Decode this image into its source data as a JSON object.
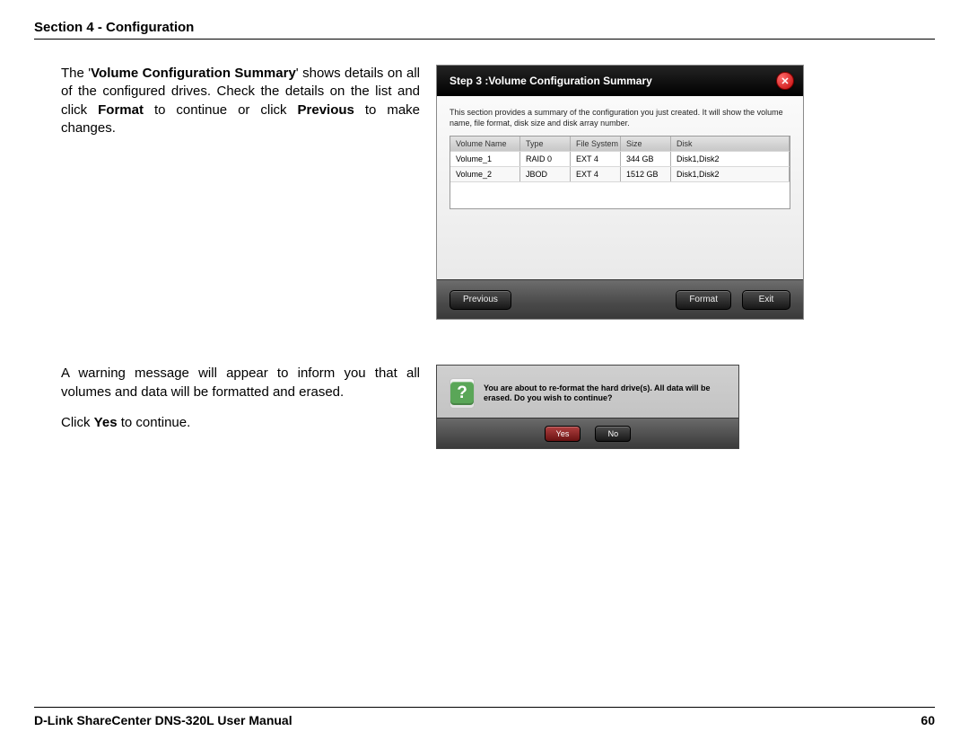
{
  "header": "Section 4 - Configuration",
  "para1_a": "The '",
  "para1_b": "Volume Configuration Summary",
  "para1_c": "' shows details on all of the configured drives. Check the details on the list and click ",
  "para1_d": "Format",
  "para1_e": " to continue or click ",
  "para1_f": "Previous",
  "para1_g": " to make changes.",
  "wizard": {
    "title": "Step 3 :Volume Configuration Summary",
    "desc": "This section provides a summary of the configuration you just created. It will show the volume name, file format, disk size and disk array number.",
    "headers": {
      "name": "Volume Name",
      "type": "Type",
      "fs": "File System",
      "size": "Size",
      "disk": "Disk"
    },
    "rows": [
      {
        "name": "Volume_1",
        "type": "RAID 0",
        "fs": "EXT 4",
        "size": "344 GB",
        "disk": "Disk1,Disk2"
      },
      {
        "name": "Volume_2",
        "type": "JBOD",
        "fs": "EXT 4",
        "size": "1512 GB",
        "disk": "Disk1,Disk2"
      }
    ],
    "previous": "Previous",
    "format": "Format",
    "exit": "Exit"
  },
  "para2": "A warning message will appear to inform you that all volumes and data will be formatted and erased.",
  "para3_a": "Click ",
  "para3_b": "Yes",
  "para3_c": " to continue.",
  "dialog": {
    "text": "You are about to re-format the hard drive(s). All data will be erased. Do you wish to continue?",
    "yes": "Yes",
    "no": "No"
  },
  "footer": {
    "manual": "D-Link ShareCenter DNS-320L User Manual",
    "page": "60"
  }
}
